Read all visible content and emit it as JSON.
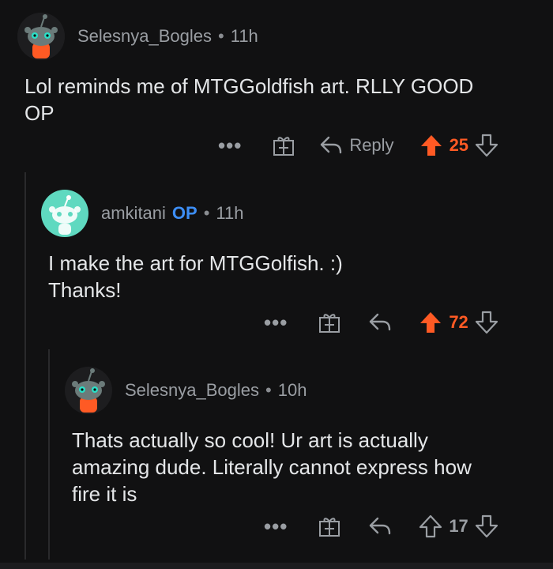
{
  "colors": {
    "upvote_active": "#ff5a24",
    "op_badge": "#3d8ef5",
    "background": "#111112"
  },
  "comments": [
    {
      "username": "Selesnya_Bogles",
      "separator": "•",
      "time": "11h",
      "body": "Lol reminds me of MTGGoldfish art. RLLY GOOD\nOP",
      "actions": {
        "more": "•••",
        "reply": "Reply",
        "votes": "25",
        "upvoted": true
      },
      "icons": [
        "more-icon",
        "gift-icon",
        "reply-arrow-icon",
        "upvote-icon",
        "downvote-icon"
      ]
    },
    {
      "username": "amkitani",
      "op_badge": "OP",
      "separator": "•",
      "time": "11h",
      "body": "I make the art for MTGGolfish. :)\nThanks!",
      "actions": {
        "more": "•••",
        "votes": "72",
        "upvoted": true
      }
    },
    {
      "username": "Selesnya_Bogles",
      "separator": "•",
      "time": "10h",
      "body": "Thats actually so cool! Ur art is actually\namazing dude. Literally cannot express how\nfire it is",
      "actions": {
        "more": "•••",
        "votes": "17",
        "upvoted": false
      }
    }
  ]
}
